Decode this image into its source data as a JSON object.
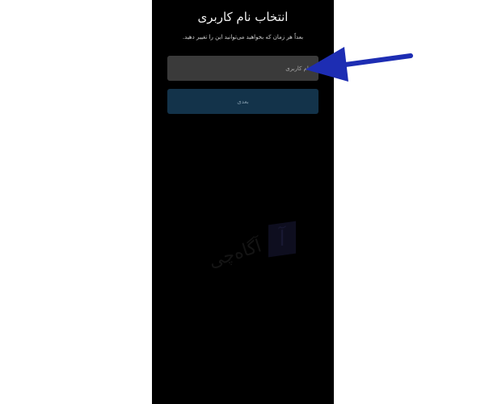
{
  "screen": {
    "title": "انتخاب نام کاربری",
    "subtitle": "بعداً هر زمان که بخواهید می‌توانید این را تغییر دهید."
  },
  "form": {
    "username_placeholder": "نام کاربری",
    "next_label": "بعدی"
  },
  "watermark": {
    "text": "آگاه‌چی",
    "logo_letter": "آ"
  },
  "annotation": {
    "arrow_color": "#1d2db3"
  },
  "colors": {
    "screen_background": "#000000",
    "input_background": "#3a3a3a",
    "button_background": "#13334a"
  }
}
